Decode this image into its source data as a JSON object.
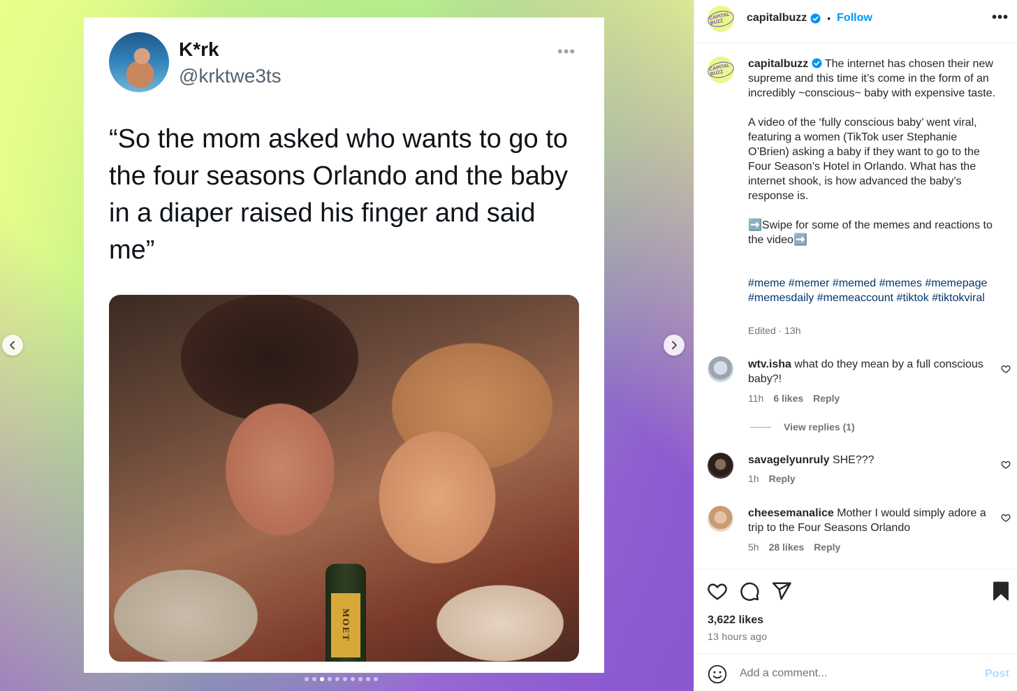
{
  "tweet": {
    "name": "K*rk",
    "handle": "@krktwe3ts",
    "more": "•••",
    "text": "“So the mom asked who wants to go to the four seasons Orlando and the baby in a diaper raised his finger and said me”",
    "bottle_label": "MOET"
  },
  "carousel": {
    "dot_count": 10,
    "active_index": 2
  },
  "post": {
    "logo_text": "CAPITAL BUZZ",
    "username": "capitalbuzz",
    "separator": "•",
    "follow_label": "Follow",
    "more": "•••",
    "caption": "The internet has chosen their new supreme and this time it’s come in the form of an incredibly ~conscious~ baby with expensive taste.\n\nA video of the ‘fully conscious baby’ went viral, featuring a women (TikTok user Stephanie O’Brien) asking a baby if they want to go to the Four Season’s Hotel in Orlando. What has the internet shook, is how advanced the baby’s response is.\n\n➡️Swipe for some of the memes and reactions to the video➡️",
    "hashtags": "#meme #memer #memed #memes #memepage #memesdaily #memeaccount #tiktok #tiktokviral",
    "edited": "Edited · 13h"
  },
  "comments": [
    {
      "user": "wtv.isha",
      "text": "what do they mean by a full conscious baby?!",
      "time": "11h",
      "likes": "6 likes",
      "reply": "Reply",
      "view_replies": "View replies (1)"
    },
    {
      "user": "savagelyunruly",
      "text": "SHE???",
      "time": "1h",
      "likes": "",
      "reply": "Reply"
    },
    {
      "user": "cheesemanalice",
      "text": "Mother I would simply adore a trip to the Four Seasons Orlando",
      "time": "5h",
      "likes": "28 likes",
      "reply": "Reply"
    }
  ],
  "stats": {
    "likes": "3,622 likes",
    "time_ago": "13 hours ago"
  },
  "add_comment": {
    "placeholder": "Add a comment...",
    "post_label": "Post"
  },
  "colors": {
    "accent": "#0095f6",
    "hashtag": "#00376b",
    "brand_logo_bg": "#e8f88a",
    "brand_logo_fg": "#7a4cc0"
  },
  "icons": [
    "chevron-left-icon",
    "chevron-right-icon",
    "verified-badge-icon",
    "heart-icon",
    "comment-icon",
    "share-icon",
    "bookmark-icon",
    "emoji-icon",
    "more-icon"
  ]
}
